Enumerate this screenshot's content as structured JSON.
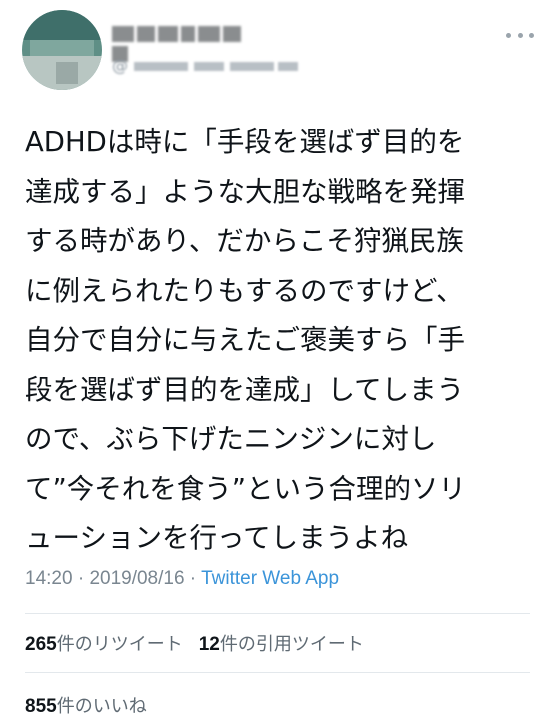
{
  "tweet": {
    "lines": [
      "ADHDは時に「手段を選ばず目的を",
      "達成する」ような大胆な戦略を発揮",
      "する時があり、だからこそ狩猟民族",
      "に例えられたりもするのですけど、",
      "自分で自分に与えたご褒美すら「手",
      "段を選ばず目的を達成」してしまう",
      "ので、ぶら下げたニンジンに対し",
      "て”今それを食う”という合理的ソリ",
      "ューションを行ってしまうよね"
    ],
    "time": "14:20",
    "separator": " · ",
    "date": "2019/08/16",
    "source": "Twitter Web App"
  },
  "stats": {
    "retweets_count": "265",
    "retweets_label": "件のリツイート",
    "quotes_count": "12",
    "quotes_label": "件の引用ツイート",
    "likes_count": "855",
    "likes_label": "件のいいね"
  },
  "icons": {
    "more": "more-horizontal-icon"
  },
  "colors": {
    "text": "#0f1419",
    "meta": "#7a8690",
    "link": "#3b94d9",
    "divider": "#e3e8ec"
  }
}
